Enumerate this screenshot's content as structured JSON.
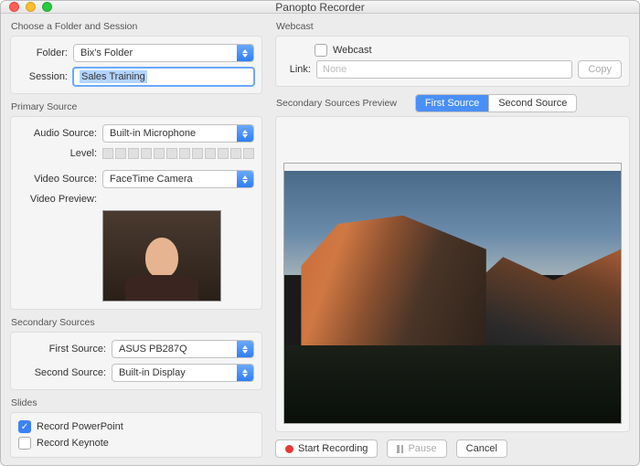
{
  "window": {
    "title": "Panopto Recorder"
  },
  "folderSession": {
    "group_label": "Choose a Folder and Session",
    "folder_label": "Folder:",
    "folder_value": "Bix's Folder",
    "session_label": "Session:",
    "session_value": "Sales Training"
  },
  "primary": {
    "group_label": "Primary Source",
    "audio_label": "Audio Source:",
    "audio_value": "Built-in Microphone",
    "level_label": "Level:",
    "video_label": "Video Source:",
    "video_value": "FaceTime Camera",
    "preview_label": "Video Preview:"
  },
  "secondary": {
    "group_label": "Secondary Sources",
    "first_label": "First Source:",
    "first_value": "ASUS PB287Q",
    "second_label": "Second Source:",
    "second_value": "Built-in Display"
  },
  "slides": {
    "group_label": "Slides",
    "ppt_label": "Record PowerPoint",
    "ppt_checked": true,
    "keynote_label": "Record Keynote",
    "keynote_checked": false
  },
  "webcast": {
    "group_label": "Webcast",
    "checkbox_label": "Webcast",
    "checked": false,
    "link_label": "Link:",
    "link_placeholder": "None",
    "copy_label": "Copy"
  },
  "preview": {
    "group_label": "Secondary Sources Preview",
    "tab1": "First Source",
    "tab2": "Second Source"
  },
  "controls": {
    "start": "Start Recording",
    "pause": "Pause",
    "cancel": "Cancel"
  }
}
